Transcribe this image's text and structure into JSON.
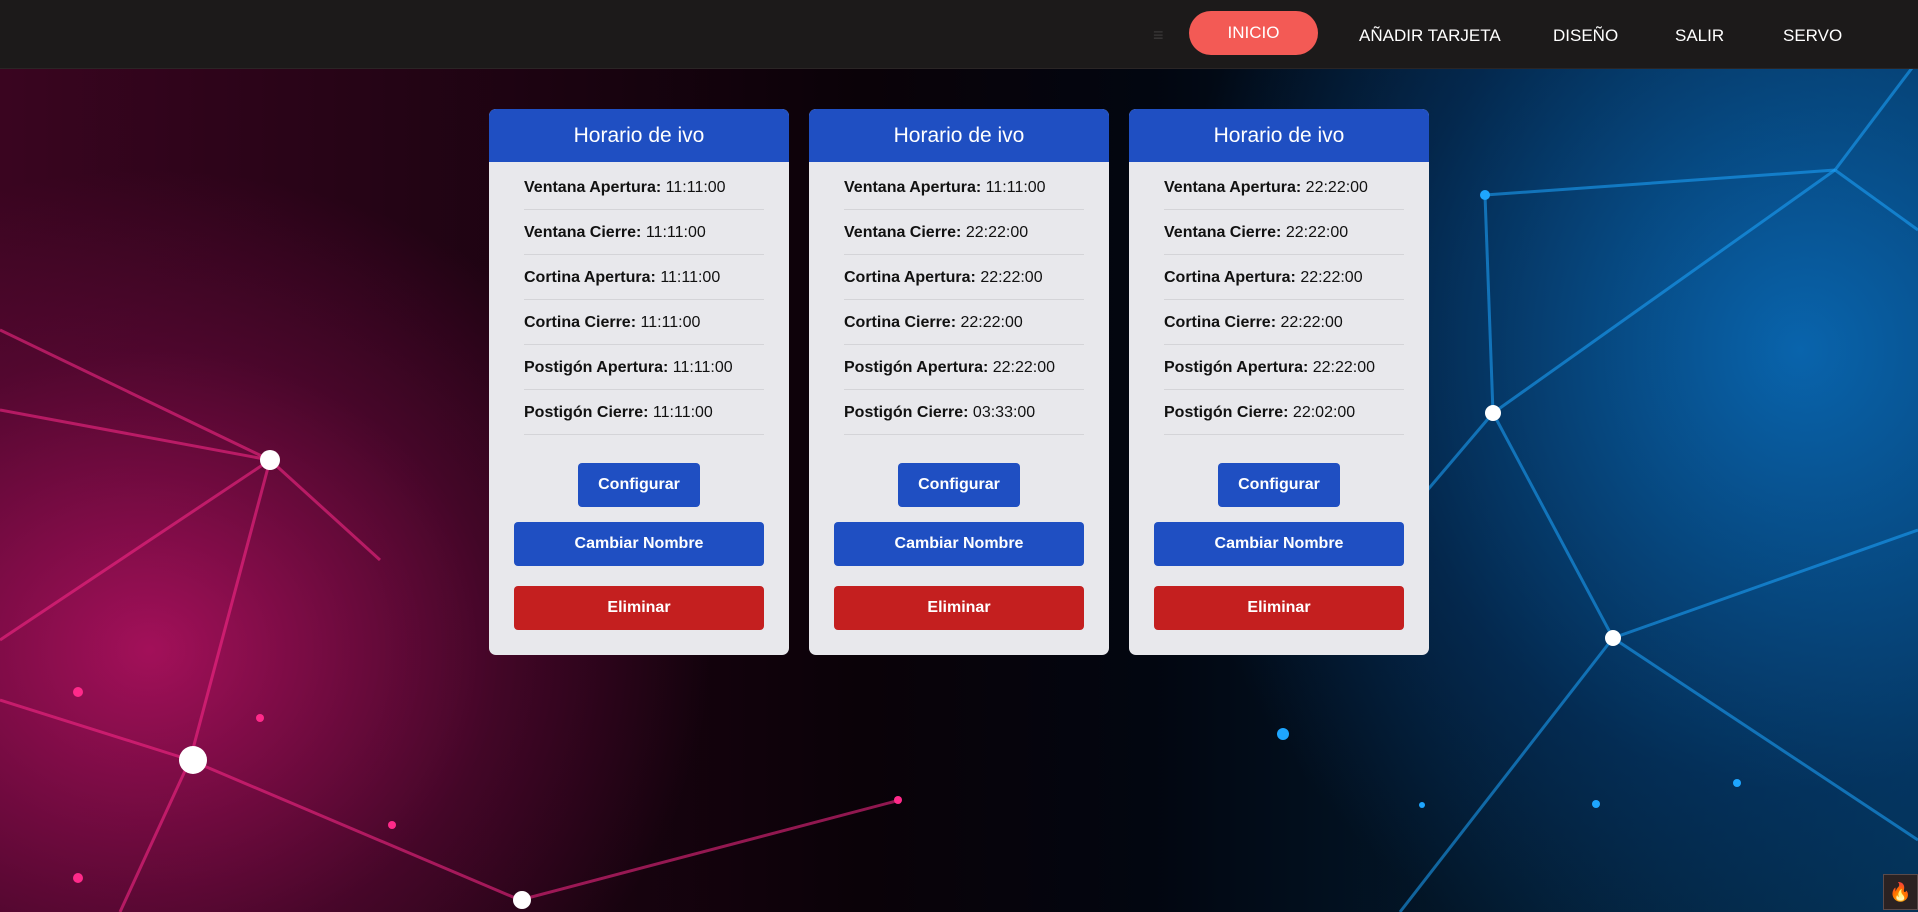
{
  "nav": {
    "menu_icon": "hamburger-icon",
    "items": [
      "INICIO",
      "AÑADIR TARJETA",
      "DISEÑO",
      "SALIR",
      "SERVO"
    ],
    "active_color": "#f35a55"
  },
  "cards": [
    {
      "title": "Horario de ivo",
      "rows": [
        {
          "label": "Ventana Apertura:",
          "value": "11:11:00"
        },
        {
          "label": "Ventana Cierre:",
          "value": "11:11:00"
        },
        {
          "label": "Cortina Apertura:",
          "value": "11:11:00"
        },
        {
          "label": "Cortina Cierre:",
          "value": "11:11:00"
        },
        {
          "label": "Postigón Apertura:",
          "value": "11:11:00"
        },
        {
          "label": "Postigón Cierre:",
          "value": "11:11:00"
        }
      ],
      "buttons": {
        "configure": "Configurar",
        "rename": "Cambiar Nombre",
        "delete": "Eliminar"
      }
    },
    {
      "title": "Horario de ivo",
      "rows": [
        {
          "label": "Ventana Apertura:",
          "value": "11:11:00"
        },
        {
          "label": "Ventana Cierre:",
          "value": "22:22:00"
        },
        {
          "label": "Cortina Apertura:",
          "value": "22:22:00"
        },
        {
          "label": "Cortina Cierre:",
          "value": "22:22:00"
        },
        {
          "label": "Postigón Apertura:",
          "value": "22:22:00"
        },
        {
          "label": "Postigón Cierre:",
          "value": "03:33:00"
        }
      ],
      "buttons": {
        "configure": "Configurar",
        "rename": "Cambiar Nombre",
        "delete": "Eliminar"
      }
    },
    {
      "title": "Horario de ivo",
      "rows": [
        {
          "label": "Ventana Apertura:",
          "value": "22:22:00"
        },
        {
          "label": "Ventana Cierre:",
          "value": "22:22:00"
        },
        {
          "label": "Cortina Apertura:",
          "value": "22:22:00"
        },
        {
          "label": "Cortina Cierre:",
          "value": "22:22:00"
        },
        {
          "label": "Postigón Apertura:",
          "value": "22:22:00"
        },
        {
          "label": "Postigón Cierre:",
          "value": "22:02:00"
        }
      ],
      "buttons": {
        "configure": "Configurar",
        "rename": "Cambiar Nombre",
        "delete": "Eliminar"
      }
    }
  ],
  "colors": {
    "card_header": "#1f4fc2",
    "primary_button": "#1f4fc2",
    "danger_button": "#c41f1f",
    "card_background": "#e8e8ec",
    "navbar_background": "#1c1a1a"
  },
  "corner_widget": {
    "icon": "flame-icon"
  }
}
